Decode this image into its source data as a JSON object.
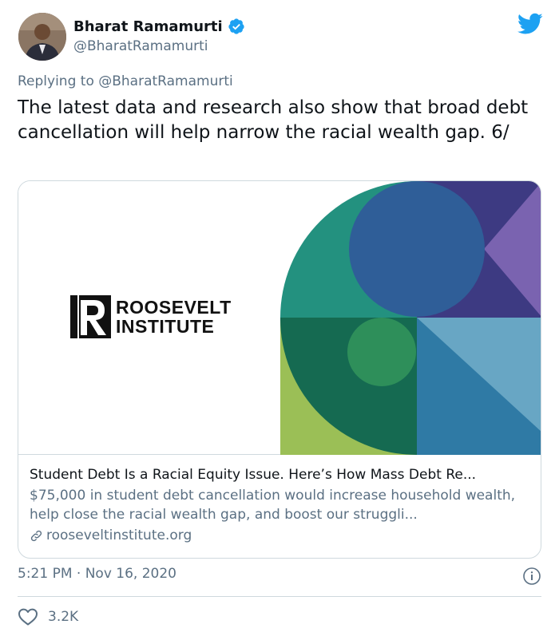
{
  "author": {
    "name": "Bharat Ramamurti",
    "handle": "@BharatRamamurti",
    "verified": true
  },
  "reply_context": {
    "prefix": "Replying to",
    "mention": "@BharatRamamurti"
  },
  "tweet": {
    "text": "The latest data and research also show that broad debt cancellation will help narrow the racial wealth gap. 6/"
  },
  "card": {
    "logo_line1": "ROOSEVELT",
    "logo_line2": "INSTITUTE",
    "title": "Student Debt Is a Racial Equity Issue. Here’s How Mass Debt Re...",
    "description": "$75,000 in student debt cancellation would increase household wealth, help close the racial wealth gap, and boost our struggli...",
    "domain": "rooseveltinstitute.org"
  },
  "meta": {
    "timestamp": "5:21 PM · Nov 16, 2020"
  },
  "engagement": {
    "likes": "3.2K"
  },
  "colors": {
    "twitter_blue": "#1da1f2",
    "secondary_text": "#5b7083",
    "border": "#cfd9de"
  },
  "icons": {
    "verified": "verified-badge-icon",
    "brand": "twitter-bird-icon",
    "link": "link-icon",
    "info": "info-icon",
    "like": "heart-icon"
  }
}
